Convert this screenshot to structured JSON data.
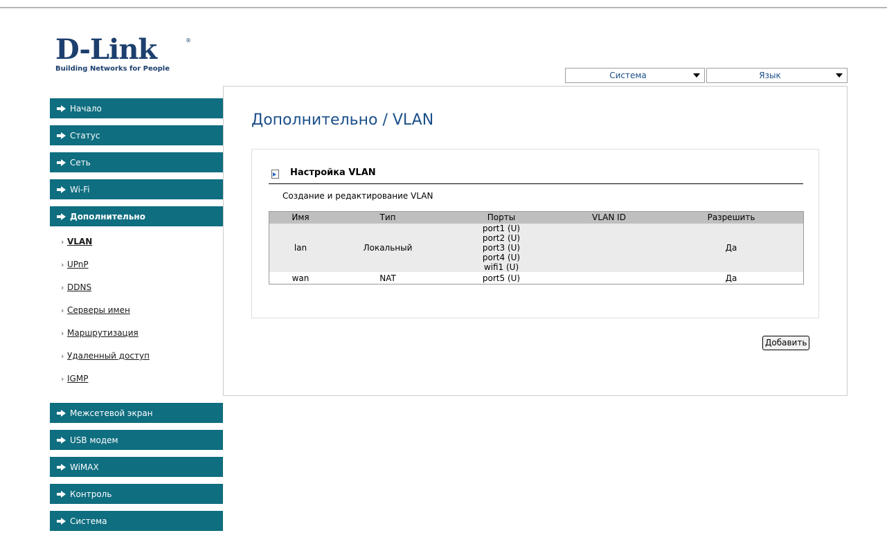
{
  "brand": {
    "name": "D-Link",
    "tagline": "Building Networks for People",
    "tm": "®"
  },
  "top_menu": {
    "system": "Система",
    "language": "Язык"
  },
  "sidebar": {
    "items": [
      {
        "label": "Начало"
      },
      {
        "label": "Статус"
      },
      {
        "label": "Сеть"
      },
      {
        "label": "Wi-Fi"
      },
      {
        "label": "Дополнительно"
      }
    ],
    "subitems": [
      {
        "label": "VLAN"
      },
      {
        "label": "UPnP"
      },
      {
        "label": "DDNS"
      },
      {
        "label": "Серверы имен"
      },
      {
        "label": "Маршрутизация"
      },
      {
        "label": "Удаленный доступ"
      },
      {
        "label": "IGMP"
      }
    ],
    "bottom_items": [
      {
        "label": "Межсетевой экран"
      },
      {
        "label": "USB модем"
      },
      {
        "label": "WiMAX"
      },
      {
        "label": "Контроль"
      },
      {
        "label": "Система"
      }
    ],
    "sub_bullet": "›"
  },
  "main": {
    "title": "Дополнительно  /  VLAN",
    "section_title": "Настройка VLAN",
    "section_desc": "Создание и редактирование VLAN",
    "table": {
      "headers": [
        "Имя",
        "Тип",
        "Порты",
        "VLAN ID",
        "Разрешить"
      ],
      "rows": [
        {
          "name": "lan",
          "type": "Локальный",
          "ports": [
            "port1 (U)",
            "port2 (U)",
            "port3 (U)",
            "port4 (U)",
            "wifi1 (U)"
          ],
          "vlan_id": "",
          "enabled": "Да"
        },
        {
          "name": "wan",
          "type": "NAT",
          "ports": [
            "port5 (U)"
          ],
          "vlan_id": "",
          "enabled": "Да"
        }
      ]
    },
    "add_button": "Добавить"
  },
  "colors": {
    "nav_bg": "#0f6e80",
    "title": "#1b4f89",
    "logo": "#1c3f6e"
  }
}
